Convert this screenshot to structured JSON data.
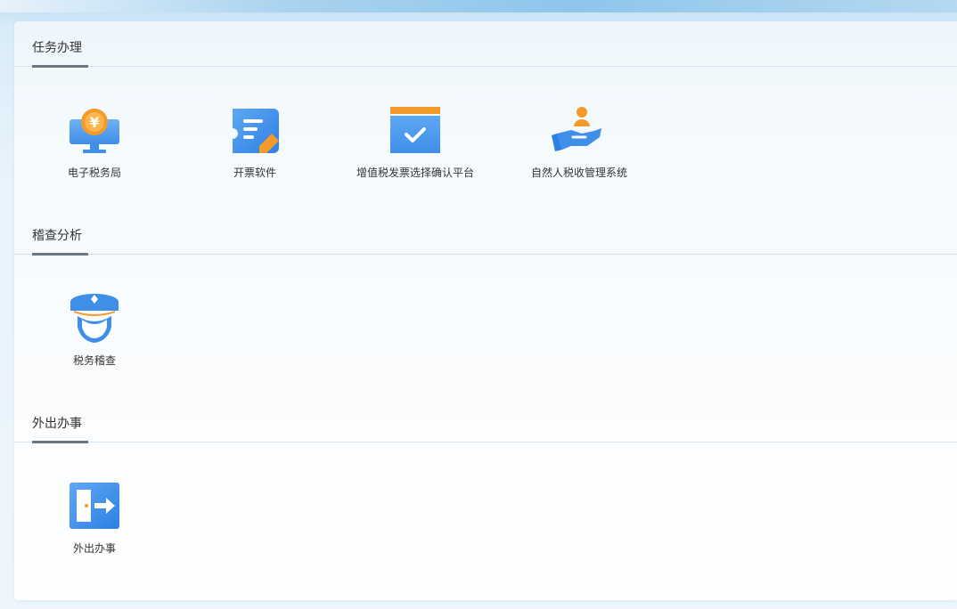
{
  "sections": [
    {
      "title": "任务办理",
      "items": [
        {
          "label": "电子税务局",
          "icon": "tax-bureau-monitor-icon"
        },
        {
          "label": "开票软件",
          "icon": "invoice-edit-icon"
        },
        {
          "label": "增值税发票选择确认平台",
          "icon": "confirm-window-icon"
        },
        {
          "label": "自然人税收管理系统",
          "icon": "person-hand-icon"
        }
      ]
    },
    {
      "title": "稽查分析",
      "items": [
        {
          "label": "税务稽查",
          "icon": "inspector-icon"
        }
      ]
    },
    {
      "title": "外出办事",
      "items": [
        {
          "label": "外出办事",
          "icon": "exit-door-icon"
        }
      ]
    }
  ],
  "colors": {
    "accent_blue": "#3f8ee8",
    "accent_orange": "#f39a2b",
    "underline": "#6b7684"
  }
}
